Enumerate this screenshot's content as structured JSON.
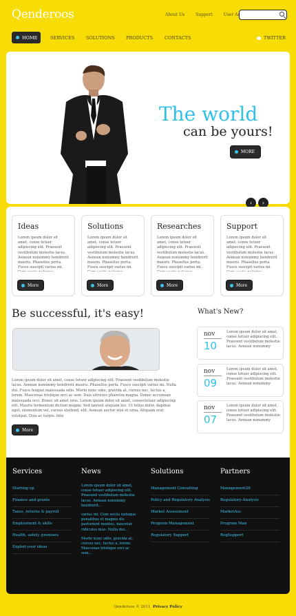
{
  "header": {
    "logo": "Qenderoos",
    "links": [
      "About Us",
      "Support",
      "User Area"
    ]
  },
  "nav": {
    "items": [
      "HOME",
      "SERVICES",
      "SOLUTIONS",
      "PRODUCTS",
      "CONTACTS"
    ],
    "twitter": "TWITTER"
  },
  "slider": {
    "headline": "The world",
    "subline": "can be yours!",
    "more": "MORE"
  },
  "features": [
    {
      "title": "Ideas",
      "text": "Lorem ipsum dolor sit amet, conse tetuer adipiscing elit. Praesent vestibulum molestie lacus. Aenean nonummy hendrerit mauris. Phasellus porta. Fusce suscipit varius mi. Cum sociis natoque",
      "btn": "More"
    },
    {
      "title": "Solutions",
      "text": "Lorem ipsum dolor sit amet, conse tetuer adipiscing elit. Praesent vestibulum molestie lacus. Aenean nonummy hendrerit mauris. Phasellus porta. Fusce suscipit varius mi. Cum sociis natoque",
      "btn": "More"
    },
    {
      "title": "Researches",
      "text": "Lorem ipsum dolor sit amet, conse tetuer adipiscing elit. Praesent vestibulum molestie lacus. Aenean nonummy hendrerit mauris. Phasellus porta. Fusce suscipit varius mi. Cum sociis natoque",
      "btn": "More"
    },
    {
      "title": "Support",
      "text": "Lorem ipsum dolor sit amet, conse tetuer adipiscing elit. Praesent vestibulum molestie lacus. Aenean nonummy hendrerit mauris. Phasellus porta. Fusce suscipit varius mi. Cum sociis natoque",
      "btn": "More"
    }
  ],
  "middle": {
    "title": "Be successful, it's easy!",
    "text": "Lorem ipsum dolor sit amet, conse tetuer adipiscing elit. Praesent vestibulum molestie lacus. Aenean nonummy hendrerit mauris. Phasellus porta. Fusce suscipit varius mi. Nulla dui. Fusce feugiat malesuada odio. Morbi nunc odio, gravida at, cursus nec, luctus a, lorem. Maecenas tristique orci ac sem. Duis ultricies pharetra magna. Donec accumsan malesuada orci. Donec sit amet eros. Lorem ipsum dolor sit amet, consectetuer adipiscing elit. Mauris fermentum dictum magna. Sed laoreet aliquam leo. Ut tellus dolor, dapibus eget, elementum vel, cursus eleifend, elit. Aenean auctor wisi et urna. Aliquam erat volutpat. Duis ac turpis. Inte",
    "btn": "More"
  },
  "whats_new": {
    "title": "What's New?",
    "items": [
      {
        "mon": "nov",
        "day": "10",
        "text": "Lorem ipsum dolor sit amet, conse tetuer adipiscing elit. Praesent vestibulum molestie lacus. Aenean nonummy"
      },
      {
        "mon": "nov",
        "day": "09",
        "text": "Lorem ipsum dolor sit amet, conse tetuer adipiscing elit. Praesent vestibulum molestie lacus. Aenean nonummy"
      },
      {
        "mon": "nov",
        "day": "07",
        "text": "Lorem ipsum dolor sit amet, conse tetuer adipiscing elit. Praesent vestibulum molestie lacus. Aenean nonummy"
      }
    ]
  },
  "footer": {
    "services": {
      "title": "Services",
      "links": [
        "Starting up",
        "Finance and grants",
        "Taxes, returns & payroll",
        "Employment & skills",
        "Health, safety, premises",
        "Exploit your ideas"
      ]
    },
    "news": {
      "title": "News",
      "texts": [
        "Lorem ipsum dolor sit amet, conse tetuer adipiscing elit. Praesent vestibulum molestie lacus. Aenean nonummy hendrerit...",
        "varius mi. Cum sociis natoque penatibus et magnis dis parturient montes, nascetur ridiculus mus. Nulla dui...",
        "Morbi nunc odio, gravida at, cursus nec, luctus a, lorem. Maecenas tristique orci ac sem..."
      ]
    },
    "solutions": {
      "title": "Solutions",
      "links": [
        "Management Consulting",
        "Policy and Regulatory Analysis",
        "Market Assessment",
        "Program Management",
        "Regulatory Support"
      ]
    },
    "partners": {
      "title": "Partners",
      "links": [
        "Management20",
        "Regulatory-Analysis",
        "MarketAss",
        "Program Man",
        "RegSupport"
      ]
    }
  },
  "copyright": {
    "text": "Qenderoos © 2011",
    "policy": "Privacy Policy"
  },
  "colors": {
    "accent": "#2fc0e8",
    "background": "#f7dc06",
    "dark": "#111111"
  }
}
